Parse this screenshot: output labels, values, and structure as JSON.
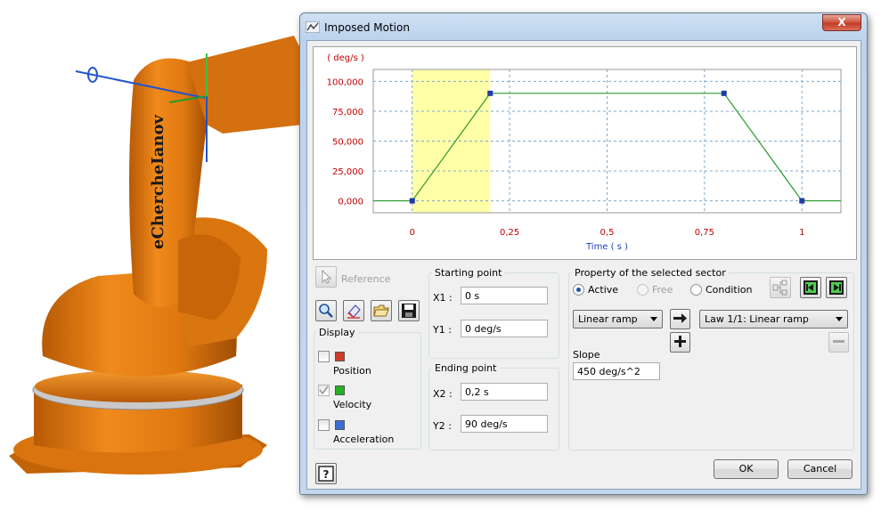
{
  "window": {
    "title": "Imposed Motion",
    "close_label": "X"
  },
  "background": {
    "watermark": "eChercheIanov"
  },
  "chart_data": {
    "type": "line",
    "ylabel": "( deg/s )",
    "xlabel": "Time ( s )",
    "ylim": [
      -10000,
      110000
    ],
    "xlim": [
      -0.1,
      1.1
    ],
    "y_ticks": [
      {
        "value": 100000,
        "label": "100,000"
      },
      {
        "value": 75000,
        "label": "75,000"
      },
      {
        "value": 50000,
        "label": "50,000"
      },
      {
        "value": 25000,
        "label": "25,000"
      },
      {
        "value": 0,
        "label": "0,000"
      }
    ],
    "x_ticks": [
      {
        "value": 0,
        "label": "0"
      },
      {
        "value": 0.25,
        "label": "0,25"
      },
      {
        "value": 0.5,
        "label": "0,5"
      },
      {
        "value": 0.75,
        "label": "0,75"
      },
      {
        "value": 1,
        "label": "1"
      }
    ],
    "series": [
      {
        "x": [
          -0.1,
          0,
          0.2,
          0.8,
          1,
          1.1
        ],
        "y": [
          0,
          0,
          90000,
          90000,
          0,
          0
        ]
      }
    ],
    "markers": [
      {
        "x": 0,
        "y": 0
      },
      {
        "x": 0.2,
        "y": 90000
      },
      {
        "x": 0.8,
        "y": 90000
      },
      {
        "x": 1,
        "y": 0
      }
    ],
    "highlight_x": [
      0,
      0.2
    ],
    "grid": true,
    "colors": {
      "line": "#2a9a2a",
      "highlight": "#ffffa8",
      "grid": "#7fa9cc",
      "axis_text": "#c00000",
      "xlabel_text": "#1f3fbf",
      "marker": "#1f3aa8"
    }
  },
  "left_panel": {
    "reference_label": "Reference",
    "display_title": "Display",
    "display_items": [
      {
        "label": "Position",
        "checked": false,
        "color": "#d03a2a"
      },
      {
        "label": "Velocity",
        "checked": true,
        "color": "#22b422"
      },
      {
        "label": "Acceleration",
        "checked": false,
        "color": "#3a6ed8"
      }
    ]
  },
  "starting_point": {
    "title": "Starting point",
    "x1_label": "X1 :",
    "x1_value": "0 s",
    "y1_label": "Y1 :",
    "y1_value": "0 deg/s"
  },
  "ending_point": {
    "title": "Ending point",
    "x2_label": "X2 :",
    "x2_value": "0,2 s",
    "y2_label": "Y2 :",
    "y2_value": "90 deg/s"
  },
  "sector": {
    "title": "Property of the selected sector",
    "radios": [
      {
        "label": "Active",
        "checked": true,
        "enabled": true
      },
      {
        "label": "Free",
        "checked": false,
        "enabled": false
      },
      {
        "label": "Condition",
        "checked": false,
        "enabled": true
      }
    ],
    "type_combo": "Linear ramp",
    "law_combo": "Law 1/1: Linear ramp",
    "slope_label": "Slope",
    "slope_value": "450 deg/s^2"
  },
  "buttons": {
    "ok": "OK",
    "cancel": "Cancel",
    "help": "?"
  }
}
